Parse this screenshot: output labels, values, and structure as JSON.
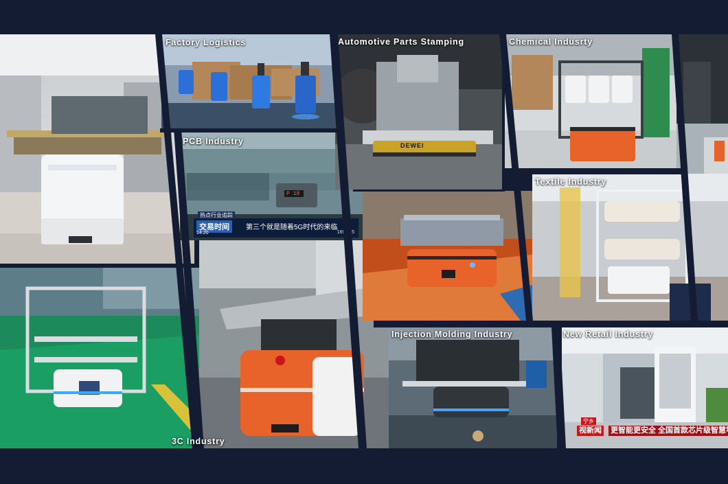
{
  "collage": {
    "panels": {
      "factory_logistics": {
        "label": "Factory Logistics"
      },
      "automotive": {
        "label": "Automotive Parts Stamping",
        "brand": "DEWEI"
      },
      "chemical": {
        "label": "Chemical Indusrty"
      },
      "pcb": {
        "label": "PCB Industry",
        "news_tag": "热点行业追踪",
        "news_title": "交易时间",
        "news_text": "第三个就是随着5G时代的来临",
        "ticker_time": "14:20",
        "ticker_value": "1694.45",
        "display_text": "P 18"
      },
      "textile": {
        "label": "Textile Industry"
      },
      "injection": {
        "label": "Injection Molding Industry"
      },
      "new_retail": {
        "label": "New Retail Industry",
        "channel_tag": "宁乡",
        "channel": "视新闻",
        "headline": "更智能更安全  全国首款芯片级智慧零"
      },
      "c3": {
        "label": "3C Industry"
      }
    },
    "colors": {
      "background": "#141c34",
      "robot_orange": "#e8632a",
      "robot_white": "#eceff2",
      "robot_blue": "#2c6fd6",
      "news_red": "#c8161d"
    }
  }
}
